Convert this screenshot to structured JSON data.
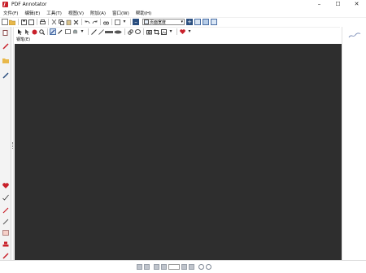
{
  "window": {
    "title": "PDF Annotator",
    "controls": {
      "minimize": "–",
      "maximize": "☐",
      "close": "✕"
    }
  },
  "menu": {
    "items": [
      "文件(F)",
      "编辑(E)",
      "工具(T)",
      "视图(V)",
      "附加(A)",
      "窗口(W)",
      "帮助(H)"
    ]
  },
  "toolbar": {
    "zoom_value": "页面宽度",
    "zoom_arrow": "▾",
    "zoom_in": "+",
    "zoom_out": "–"
  },
  "annotation_toolbar": {
    "pen_label": "钢笔(E)",
    "icons": [
      "select-arrow-icon",
      "select-region-icon",
      "stamp-icon",
      "magnifier-icon",
      "pen-icon",
      "marker-icon",
      "text-icon",
      "eraser-icon",
      "ruler-icon",
      "line-icon",
      "arrow-icon",
      "highlight-bar-icon",
      "ellipse-icon",
      "link-icon",
      "comment-icon",
      "camera-icon",
      "crop-icon",
      "picture-icon",
      "heart-icon"
    ]
  },
  "colors": {
    "document_background": "#2e2e2e",
    "brand_red": "#c8202a",
    "accent_blue": "#2a4e7f"
  }
}
